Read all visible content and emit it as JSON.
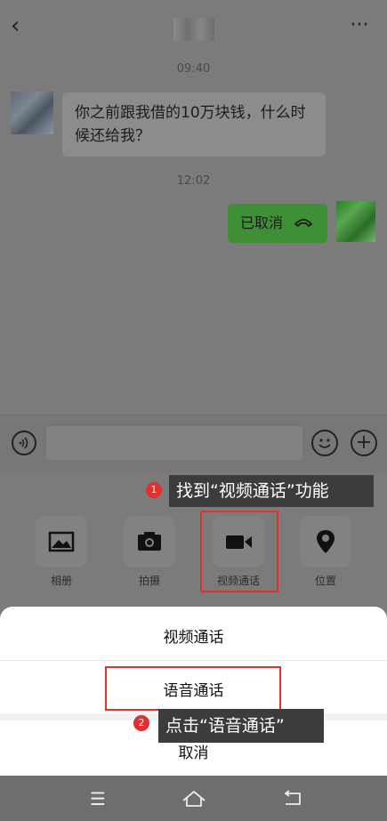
{
  "header": {
    "back_icon": "chevron-left-icon",
    "more_label": "···"
  },
  "chat": {
    "times": [
      "09:40",
      "12:02"
    ],
    "incoming_message": "你之前跟我借的10万块钱，什么时候还给我？",
    "outgoing_call_status": "已取消"
  },
  "tools": [
    {
      "label": "相册",
      "icon": "image-icon"
    },
    {
      "label": "拍摄",
      "icon": "camera-icon"
    },
    {
      "label": "视频通话",
      "icon": "video-camera-icon"
    },
    {
      "label": "位置",
      "icon": "location-pin-icon"
    }
  ],
  "annotations": {
    "step1_num": "1",
    "step1_text": "找到“视频通话”功能",
    "step2_num": "2",
    "step2_text": "点击“语音通话”"
  },
  "sheet": {
    "video_call": "视频通话",
    "voice_call": "语音通话",
    "cancel": "取消"
  },
  "navbar": {
    "menu": "☰",
    "home": "⌂",
    "back": "⮌"
  },
  "colors": {
    "accent_red": "#e03030",
    "outgoing_bubble": "#3e8f35"
  }
}
